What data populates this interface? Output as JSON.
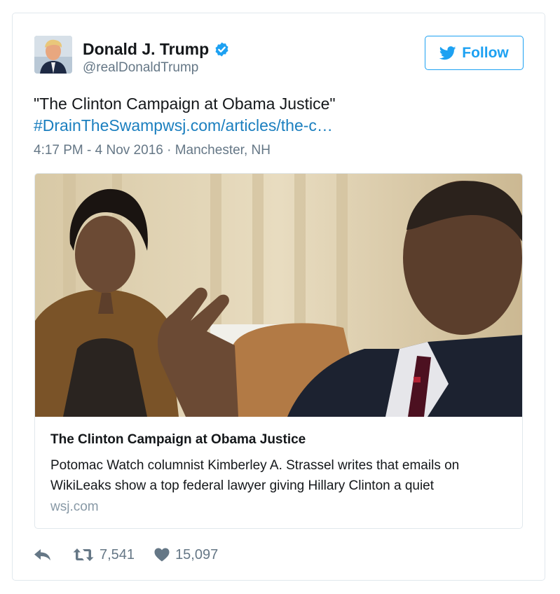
{
  "author": {
    "name": "Donald J. Trump",
    "handle": "@realDonaldTrump",
    "verified_icon": "verified-badge-icon"
  },
  "follow_button": {
    "label": "Follow",
    "icon": "twitter-bird-icon"
  },
  "tweet": {
    "text": "\"The Clinton Campaign at Obama Justice\"",
    "link": "#DrainTheSwampwsj.com/articles/the-c…",
    "time": "4:17 PM - 4 Nov 2016",
    "separator": "·",
    "location": "Manchester, NH"
  },
  "card": {
    "title": "The Clinton Campaign at Obama Justice",
    "description": "Potomac Watch columnist Kimberley A. Strassel writes that emails on WikiLeaks show a top federal lawyer giving Hillary Clinton a quiet",
    "domain": "wsj.com"
  },
  "actions": {
    "reply_icon": "reply-icon",
    "retweet_icon": "retweet-icon",
    "retweet_count": "7,541",
    "like_icon": "heart-icon",
    "like_count": "15,097"
  },
  "colors": {
    "accent": "#1da1f2",
    "link": "#1b7fbf",
    "secondary_text": "#657786"
  }
}
